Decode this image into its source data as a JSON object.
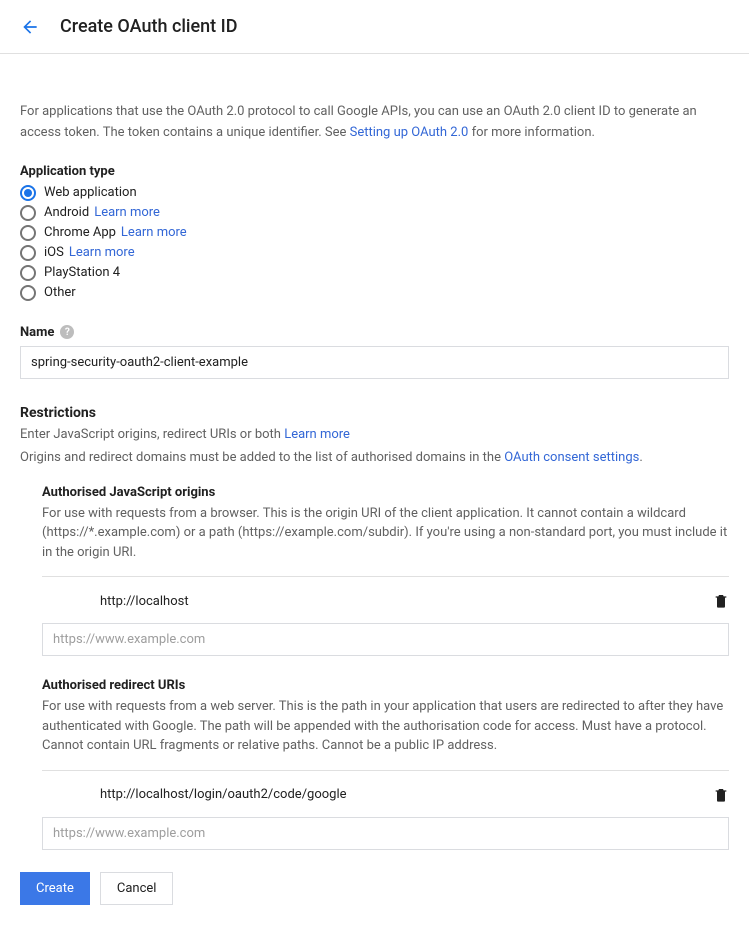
{
  "header": {
    "title": "Create OAuth client ID"
  },
  "intro": {
    "text_before": "For applications that use the OAuth 2.0 protocol to call Google APIs, you can use an OAuth 2.0 client ID to generate an access token. The token contains a unique identifier. See ",
    "link": "Setting up OAuth 2.0",
    "text_after": " for more information."
  },
  "app_type": {
    "label": "Application type",
    "learn_more": "Learn more",
    "options": [
      {
        "label": "Web application",
        "has_learn_more": false
      },
      {
        "label": "Android",
        "has_learn_more": true
      },
      {
        "label": "Chrome App",
        "has_learn_more": true
      },
      {
        "label": "iOS",
        "has_learn_more": true
      },
      {
        "label": "PlayStation 4",
        "has_learn_more": false
      },
      {
        "label": "Other",
        "has_learn_more": false
      }
    ]
  },
  "name_field": {
    "label": "Name",
    "value": "spring-security-oauth2-client-example"
  },
  "restrictions": {
    "title": "Restrictions",
    "subtitle_before": "Enter JavaScript origins, redirect URIs or both ",
    "subtitle_link": "Learn more",
    "note_before": "Origins and redirect domains must be added to the list of authorised domains in the ",
    "note_link": "OAuth consent settings",
    "note_after": "."
  },
  "js_origins": {
    "title": "Authorised JavaScript origins",
    "description": "For use with requests from a browser. This is the origin URI of the client application. It cannot contain a wildcard (https://*.example.com) or a path (https://example.com/subdir). If you're using a non-standard port, you must include it in the origin URI.",
    "entries": [
      "http://localhost"
    ],
    "placeholder": "https://www.example.com"
  },
  "redirect_uris": {
    "title": "Authorised redirect URIs",
    "description": "For use with requests from a web server. This is the path in your application that users are redirected to after they have authenticated with Google. The path will be appended with the authorisation code for access. Must have a protocol. Cannot contain URL fragments or relative paths. Cannot be a public IP address.",
    "entries": [
      "http://localhost/login/oauth2/code/google"
    ],
    "placeholder": "https://www.example.com"
  },
  "buttons": {
    "create": "Create",
    "cancel": "Cancel"
  }
}
